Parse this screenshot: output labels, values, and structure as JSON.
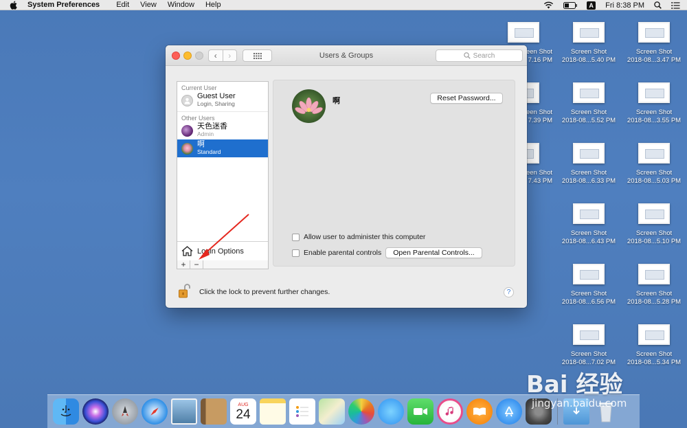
{
  "menubar": {
    "app_name": "System Preferences",
    "items": [
      "Edit",
      "View",
      "Window",
      "Help"
    ],
    "input_source": "A",
    "clock": "Fri 8:38 PM"
  },
  "window": {
    "title": "Users & Groups",
    "search_placeholder": "Search",
    "current_user_label": "Current User",
    "other_users_label": "Other Users",
    "users": {
      "guest": {
        "name": "Guest User",
        "role": "Login, Sharing"
      },
      "admin": {
        "name": "天色迷香",
        "role": "Admin"
      },
      "standard": {
        "name": "啊",
        "role": "Standard"
      }
    },
    "login_options_label": "Login Options",
    "add_label": "+",
    "remove_label": "−",
    "selected_user_name": "啊",
    "reset_password_label": "Reset Password...",
    "allow_admin_label": "Allow user to administer this computer",
    "enable_parental_label": "Enable parental controls",
    "open_parental_label": "Open Parental Controls...",
    "lock_text": "Click the lock to prevent further changes.",
    "help_label": "?"
  },
  "desktop": {
    "icon_title": "Screen Shot",
    "icons": [
      {
        "title": "Screen Shot",
        "subtitle": "7.16 PM"
      },
      {
        "title": "Screen Shot",
        "subtitle": "2018-08...5.40 PM"
      },
      {
        "title": "Screen Shot",
        "subtitle": "2018-08...3.47 PM"
      },
      {
        "title": "Screen Shot",
        "subtitle": "7.39 PM"
      },
      {
        "title": "Screen Shot",
        "subtitle": "2018-08...5.52 PM"
      },
      {
        "title": "Screen Shot",
        "subtitle": "2018-08...3.55 PM"
      },
      {
        "title": "Screen Shot",
        "subtitle": "7.43 PM"
      },
      {
        "title": "Screen Shot",
        "subtitle": "2018-08...6.33 PM"
      },
      {
        "title": "Screen Shot",
        "subtitle": "2018-08...5.03 PM"
      },
      {
        "title": "Screen Shot",
        "subtitle": "2018-08...6.43 PM"
      },
      {
        "title": "Screen Shot",
        "subtitle": "2018-08...5.10 PM"
      },
      {
        "title": "Screen Shot",
        "subtitle": "2018-08...6.56 PM"
      },
      {
        "title": "Screen Shot",
        "subtitle": "2018-08...5.28 PM"
      },
      {
        "title": "Screen Shot",
        "subtitle": "2018-08...7.02 PM"
      },
      {
        "title": "Screen Shot",
        "subtitle": "2018-08...5.34 PM"
      }
    ]
  },
  "dock": {
    "calendar_month": "AUG",
    "calendar_day": "24",
    "icons": [
      "finder-icon",
      "siri-icon",
      "launchpad-icon",
      "safari-icon",
      "photo-preview-icon",
      "contacts-icon",
      "calendar-icon",
      "notes-icon",
      "reminders-icon",
      "maps-icon",
      "photos-icon",
      "messages-icon",
      "facetime-icon",
      "itunes-icon",
      "ibooks-icon",
      "app-store-icon",
      "system-preferences-icon",
      "downloads-icon",
      "trash-icon"
    ]
  },
  "watermark": {
    "brand": "Bai 经验",
    "url": "jingyan.baidu.com"
  },
  "colors": {
    "desktop": "#4f7fbf",
    "selection": "#1f6fce",
    "annotation_arrow": "#e5281f"
  }
}
